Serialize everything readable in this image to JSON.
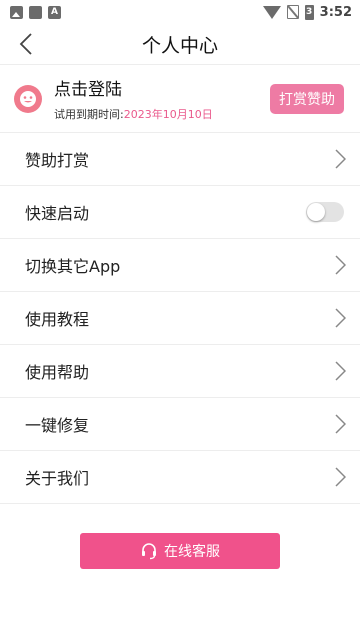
{
  "status_bar": {
    "time": "3:52",
    "battery_text": "3",
    "icons": [
      "image-icon",
      "square-icon",
      "a-icon",
      "wifi-icon",
      "no-sim-icon",
      "battery-icon"
    ]
  },
  "header": {
    "title": "个人中心",
    "back_icon": "chevron-left-icon"
  },
  "profile": {
    "login_text": "点击登陆",
    "trial_label": "试用到期时间:",
    "trial_date": "2023年10月10日",
    "reward_button": "打赏赞助",
    "avatar_icon": "avatar-face-icon"
  },
  "menu": {
    "items": [
      {
        "label": "赞助打赏",
        "control": "chevron"
      },
      {
        "label": "快速启动",
        "control": "toggle",
        "toggle_on": false
      },
      {
        "label": "切换其它App",
        "control": "chevron"
      },
      {
        "label": "使用教程",
        "control": "chevron"
      },
      {
        "label": "使用帮助",
        "control": "chevron"
      },
      {
        "label": "一键修复",
        "control": "chevron"
      },
      {
        "label": "关于我们",
        "control": "chevron"
      }
    ]
  },
  "service": {
    "label": "在线客服",
    "icon": "headset-icon"
  },
  "colors": {
    "accent": "#f0528b",
    "reward_button": "#ee7ba4",
    "date_text": "#ea5a8c",
    "avatar": "#f07a8c"
  }
}
